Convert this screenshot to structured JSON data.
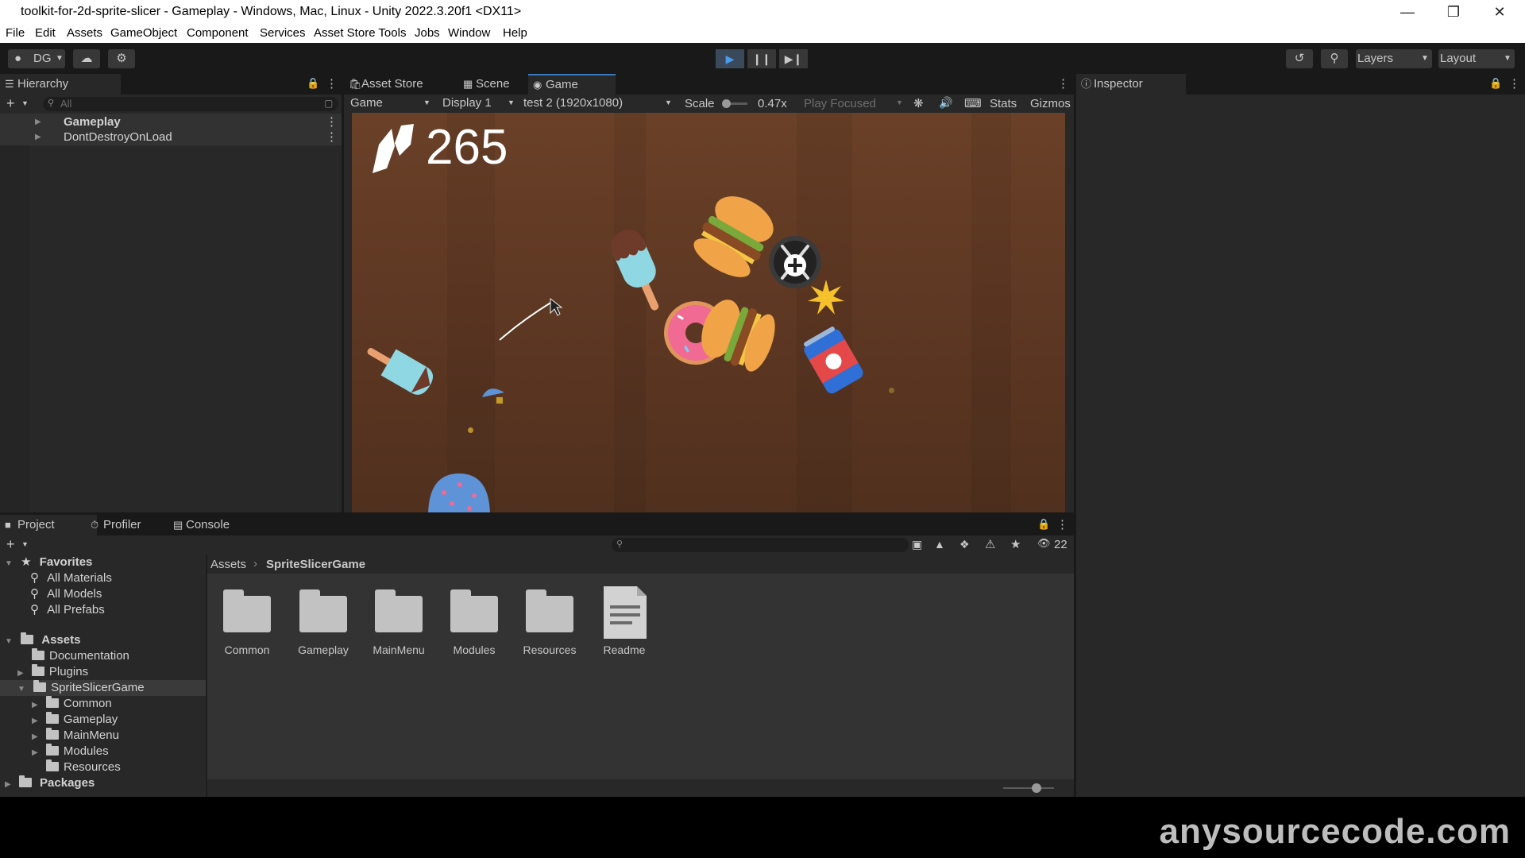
{
  "window": {
    "title": "toolkit-for-2d-sprite-slicer - Gameplay - Windows, Mac, Linux - Unity 2022.3.20f1 <DX11>",
    "controls": [
      "—",
      "❐",
      "✕"
    ]
  },
  "menu": [
    "File",
    "Edit",
    "Assets",
    "GameObject",
    "Component",
    "Services",
    "Asset Store Tools",
    "Jobs",
    "Window",
    "Help"
  ],
  "toolbar": {
    "account_label": "DG",
    "layers_label": "Layers",
    "layout_label": "Layout"
  },
  "hierarchy": {
    "tab_label": "Hierarchy",
    "search_placeholder": "All",
    "items": [
      {
        "label": "Gameplay"
      },
      {
        "label": "DontDestroyOnLoad"
      }
    ]
  },
  "center_tabs": [
    "Asset Store",
    "Scene",
    "Game"
  ],
  "game_toolbar": {
    "view": "Game",
    "display": "Display 1",
    "resolution": "test 2 (1920x1080)",
    "scale_label": "Scale",
    "scale_value": 0.47,
    "scale_text": "0.47x",
    "play_mode": "Play Focused",
    "stats_label": "Stats",
    "gizmos_label": "Gizmos"
  },
  "game": {
    "score": "265"
  },
  "inspector": {
    "tab_label": "Inspector"
  },
  "bottom_tabs": [
    "Project",
    "Profiler",
    "Console"
  ],
  "project": {
    "hidden_count": "22",
    "favorites_label": "Favorites",
    "favorites": [
      "All Materials",
      "All Models",
      "All Prefabs"
    ],
    "assets_label": "Assets",
    "assets_children": [
      "Documentation",
      "Plugins",
      "SpriteSlicerGame"
    ],
    "sprite_children": [
      "Common",
      "Gameplay",
      "MainMenu",
      "Modules",
      "Resources"
    ],
    "packages_label": "Packages",
    "breadcrumb": [
      "Assets",
      "SpriteSlicerGame"
    ],
    "grid_items": [
      "Common",
      "Gameplay",
      "MainMenu",
      "Modules",
      "Resources",
      "Readme"
    ]
  },
  "watermark": "anysourcecode.com"
}
